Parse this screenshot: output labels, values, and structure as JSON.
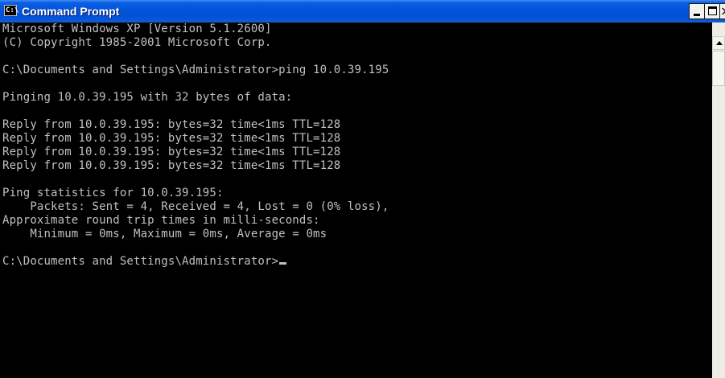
{
  "window": {
    "title": "Command Prompt",
    "icon": "console-icon",
    "icon_text": "C:\\",
    "buttons": [
      "minimize-icon",
      "maximize-icon",
      "close-icon"
    ],
    "minimize_label": "_",
    "close_label": "×"
  },
  "console": {
    "lines": [
      "Microsoft Windows XP [Version 5.1.2600]",
      "(C) Copyright 1985-2001 Microsoft Corp.",
      "",
      "C:\\Documents and Settings\\Administrator>ping 10.0.39.195",
      "",
      "Pinging 10.0.39.195 with 32 bytes of data:",
      "",
      "Reply from 10.0.39.195: bytes=32 time<1ms TTL=128",
      "Reply from 10.0.39.195: bytes=32 time<1ms TTL=128",
      "Reply from 10.0.39.195: bytes=32 time<1ms TTL=128",
      "Reply from 10.0.39.195: bytes=32 time<1ms TTL=128",
      "",
      "Ping statistics for 10.0.39.195:",
      "    Packets: Sent = 4, Received = 4, Lost = 0 (0% loss),",
      "Approximate round trip times in milli-seconds:",
      "    Minimum = 0ms, Maximum = 0ms, Average = 0ms",
      "",
      "C:\\Documents and Settings\\Administrator>"
    ],
    "text_color": "#c0c0c0",
    "background_color": "#000000"
  }
}
